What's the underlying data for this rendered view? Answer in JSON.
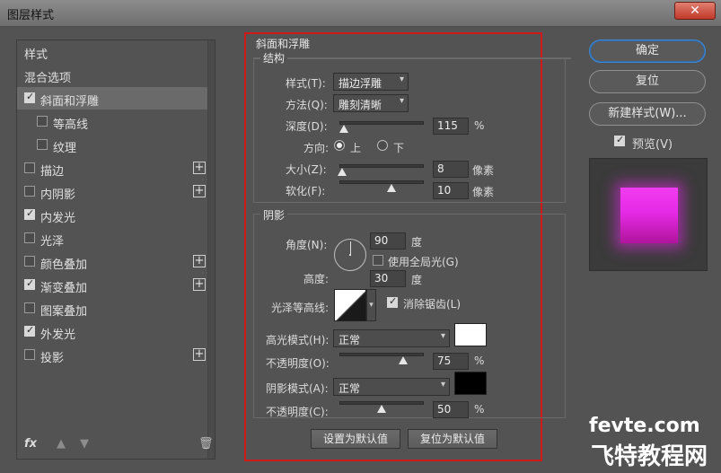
{
  "window": {
    "title": "图层样式",
    "close_glyph": "✕"
  },
  "left_panel": {
    "items": [
      {
        "label": "样式",
        "checkbox": false,
        "checked": false,
        "plus": false,
        "selected": false,
        "indent": 0
      },
      {
        "label": "混合选项",
        "checkbox": false,
        "checked": false,
        "plus": false,
        "selected": false,
        "indent": 0
      },
      {
        "label": "斜面和浮雕",
        "checkbox": true,
        "checked": true,
        "plus": false,
        "selected": true,
        "indent": 0
      },
      {
        "label": "等高线",
        "checkbox": true,
        "checked": false,
        "plus": false,
        "selected": false,
        "indent": 1
      },
      {
        "label": "纹理",
        "checkbox": true,
        "checked": false,
        "plus": false,
        "selected": false,
        "indent": 1
      },
      {
        "label": "描边",
        "checkbox": true,
        "checked": false,
        "plus": true,
        "selected": false,
        "indent": 0
      },
      {
        "label": "内阴影",
        "checkbox": true,
        "checked": false,
        "plus": true,
        "selected": false,
        "indent": 0
      },
      {
        "label": "内发光",
        "checkbox": true,
        "checked": true,
        "plus": false,
        "selected": false,
        "indent": 0
      },
      {
        "label": "光泽",
        "checkbox": true,
        "checked": false,
        "plus": false,
        "selected": false,
        "indent": 0
      },
      {
        "label": "颜色叠加",
        "checkbox": true,
        "checked": false,
        "plus": true,
        "selected": false,
        "indent": 0
      },
      {
        "label": "渐变叠加",
        "checkbox": true,
        "checked": true,
        "plus": true,
        "selected": false,
        "indent": 0
      },
      {
        "label": "图案叠加",
        "checkbox": true,
        "checked": false,
        "plus": false,
        "selected": false,
        "indent": 0
      },
      {
        "label": "外发光",
        "checkbox": true,
        "checked": true,
        "plus": false,
        "selected": false,
        "indent": 0
      },
      {
        "label": "投影",
        "checkbox": true,
        "checked": false,
        "plus": true,
        "selected": false,
        "indent": 0
      }
    ],
    "footer": {
      "fx": "fx",
      "up": "▲",
      "down": "▼",
      "trash": "🗑"
    }
  },
  "bevel": {
    "section_title": "斜面和浮雕",
    "structure": {
      "title": "结构",
      "style_label": "样式(T):",
      "style_value": "描边浮雕",
      "technique_label": "方法(Q):",
      "technique_value": "雕刻清晰",
      "depth_label": "深度(D):",
      "depth_value": "115",
      "depth_unit": "%",
      "depth_level": 0.05,
      "direction_label": "方向:",
      "direction_up": "上",
      "direction_down": "下",
      "direction_selected": "up",
      "size_label": "大小(Z):",
      "size_value": "8",
      "size_unit": "像素",
      "size_level": 0.03,
      "soften_label": "软化(F):",
      "soften_value": "10",
      "soften_unit": "像素",
      "soften_level": 0.62
    },
    "shading": {
      "title": "阴影",
      "angle_label": "角度(N):",
      "angle_value": "90",
      "angle_unit": "度",
      "global_light_label": "使用全局光(G)",
      "global_light_checked": false,
      "altitude_label": "高度:",
      "altitude_value": "30",
      "altitude_unit": "度",
      "gloss_label": "光泽等高线:",
      "antialias_label": "消除锯齿(L)",
      "antialias_checked": true,
      "highlight_mode_label": "高光模式(H):",
      "highlight_mode_value": "正常",
      "highlight_color": "#ffffff",
      "highlight_opacity_label": "不透明度(O):",
      "highlight_opacity_value": "75",
      "highlight_opacity_unit": "%",
      "highlight_opacity_level": 0.75,
      "shadow_mode_label": "阴影模式(A):",
      "shadow_mode_value": "正常",
      "shadow_color": "#000000",
      "shadow_opacity_label": "不透明度(C):",
      "shadow_opacity_value": "50",
      "shadow_opacity_unit": "%",
      "shadow_opacity_level": 0.5
    },
    "buttons": {
      "make_default": "设置为默认值",
      "reset_default": "复位为默认值"
    }
  },
  "right_panel": {
    "ok": "确定",
    "reset": "复位",
    "new_style": "新建样式(W)...",
    "preview_label": "预览(V)",
    "preview_checked": true
  },
  "watermark": {
    "line1": "fevte.com",
    "line2": "飞特教程网"
  },
  "colors": {
    "accent_border": "#d01919",
    "primary_ring": "#3c88d8"
  }
}
